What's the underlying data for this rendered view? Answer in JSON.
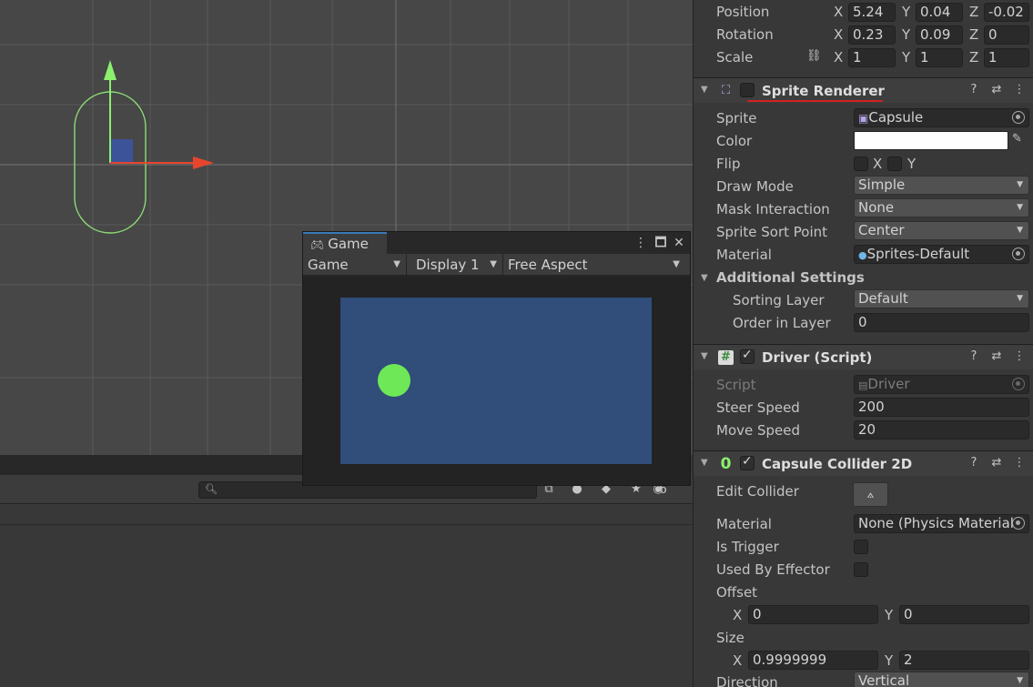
{
  "colors": {
    "scene_bg": "#474747",
    "inspector_bg": "#383838",
    "game_canvas": "#314d79",
    "game_ball": "#6ee857",
    "accent_underline": "#d32020"
  },
  "game_window": {
    "tab_label": "Game",
    "tab_icon": "gamepad-icon",
    "display_mode": "Game",
    "display": "Display 1",
    "aspect": "Free Aspect"
  },
  "hierarchy_toolbar": {
    "hidden_count": "6"
  },
  "transform": {
    "position": {
      "label": "Position",
      "x": "5.24",
      "y": "0.04",
      "z": "-0.02"
    },
    "rotation": {
      "label": "Rotation",
      "x": "0.23",
      "y": "0.09",
      "z": "0"
    },
    "scale": {
      "label": "Scale",
      "x": "1",
      "y": "1",
      "z": "1"
    }
  },
  "axes": {
    "x": "X",
    "y": "Y",
    "z": "Z"
  },
  "sprite_renderer": {
    "title": "Sprite Renderer",
    "sprite_label": "Sprite",
    "sprite_value": "Capsule",
    "color_label": "Color",
    "color_value": "#ffffff",
    "flip_label": "Flip",
    "flip_x": "X",
    "flip_y": "Y",
    "draw_mode_label": "Draw Mode",
    "draw_mode_value": "Simple",
    "mask_label": "Mask Interaction",
    "mask_value": "None",
    "sort_point_label": "Sprite Sort Point",
    "sort_point_value": "Center",
    "material_label": "Material",
    "material_value": "Sprites-Default",
    "additional_label": "Additional Settings",
    "sorting_layer_label": "Sorting Layer",
    "sorting_layer_value": "Default",
    "order_label": "Order in Layer",
    "order_value": "0"
  },
  "driver_script": {
    "title": "Driver (Script)",
    "script_label": "Script",
    "script_value": "Driver",
    "steer_label": "Steer Speed",
    "steer_value": "200",
    "move_label": "Move Speed",
    "move_value": "20"
  },
  "capsule_collider": {
    "title": "Capsule Collider 2D",
    "edit_label": "Edit Collider",
    "material_label": "Material",
    "material_value": "None (Physics Material",
    "trigger_label": "Is Trigger",
    "effector_label": "Used By Effector",
    "offset_label": "Offset",
    "offset_x": "0",
    "offset_y": "0",
    "size_label": "Size",
    "size_x": "0.9999999",
    "size_y": "2",
    "direction_label": "Direction",
    "direction_value": "Vertical"
  }
}
